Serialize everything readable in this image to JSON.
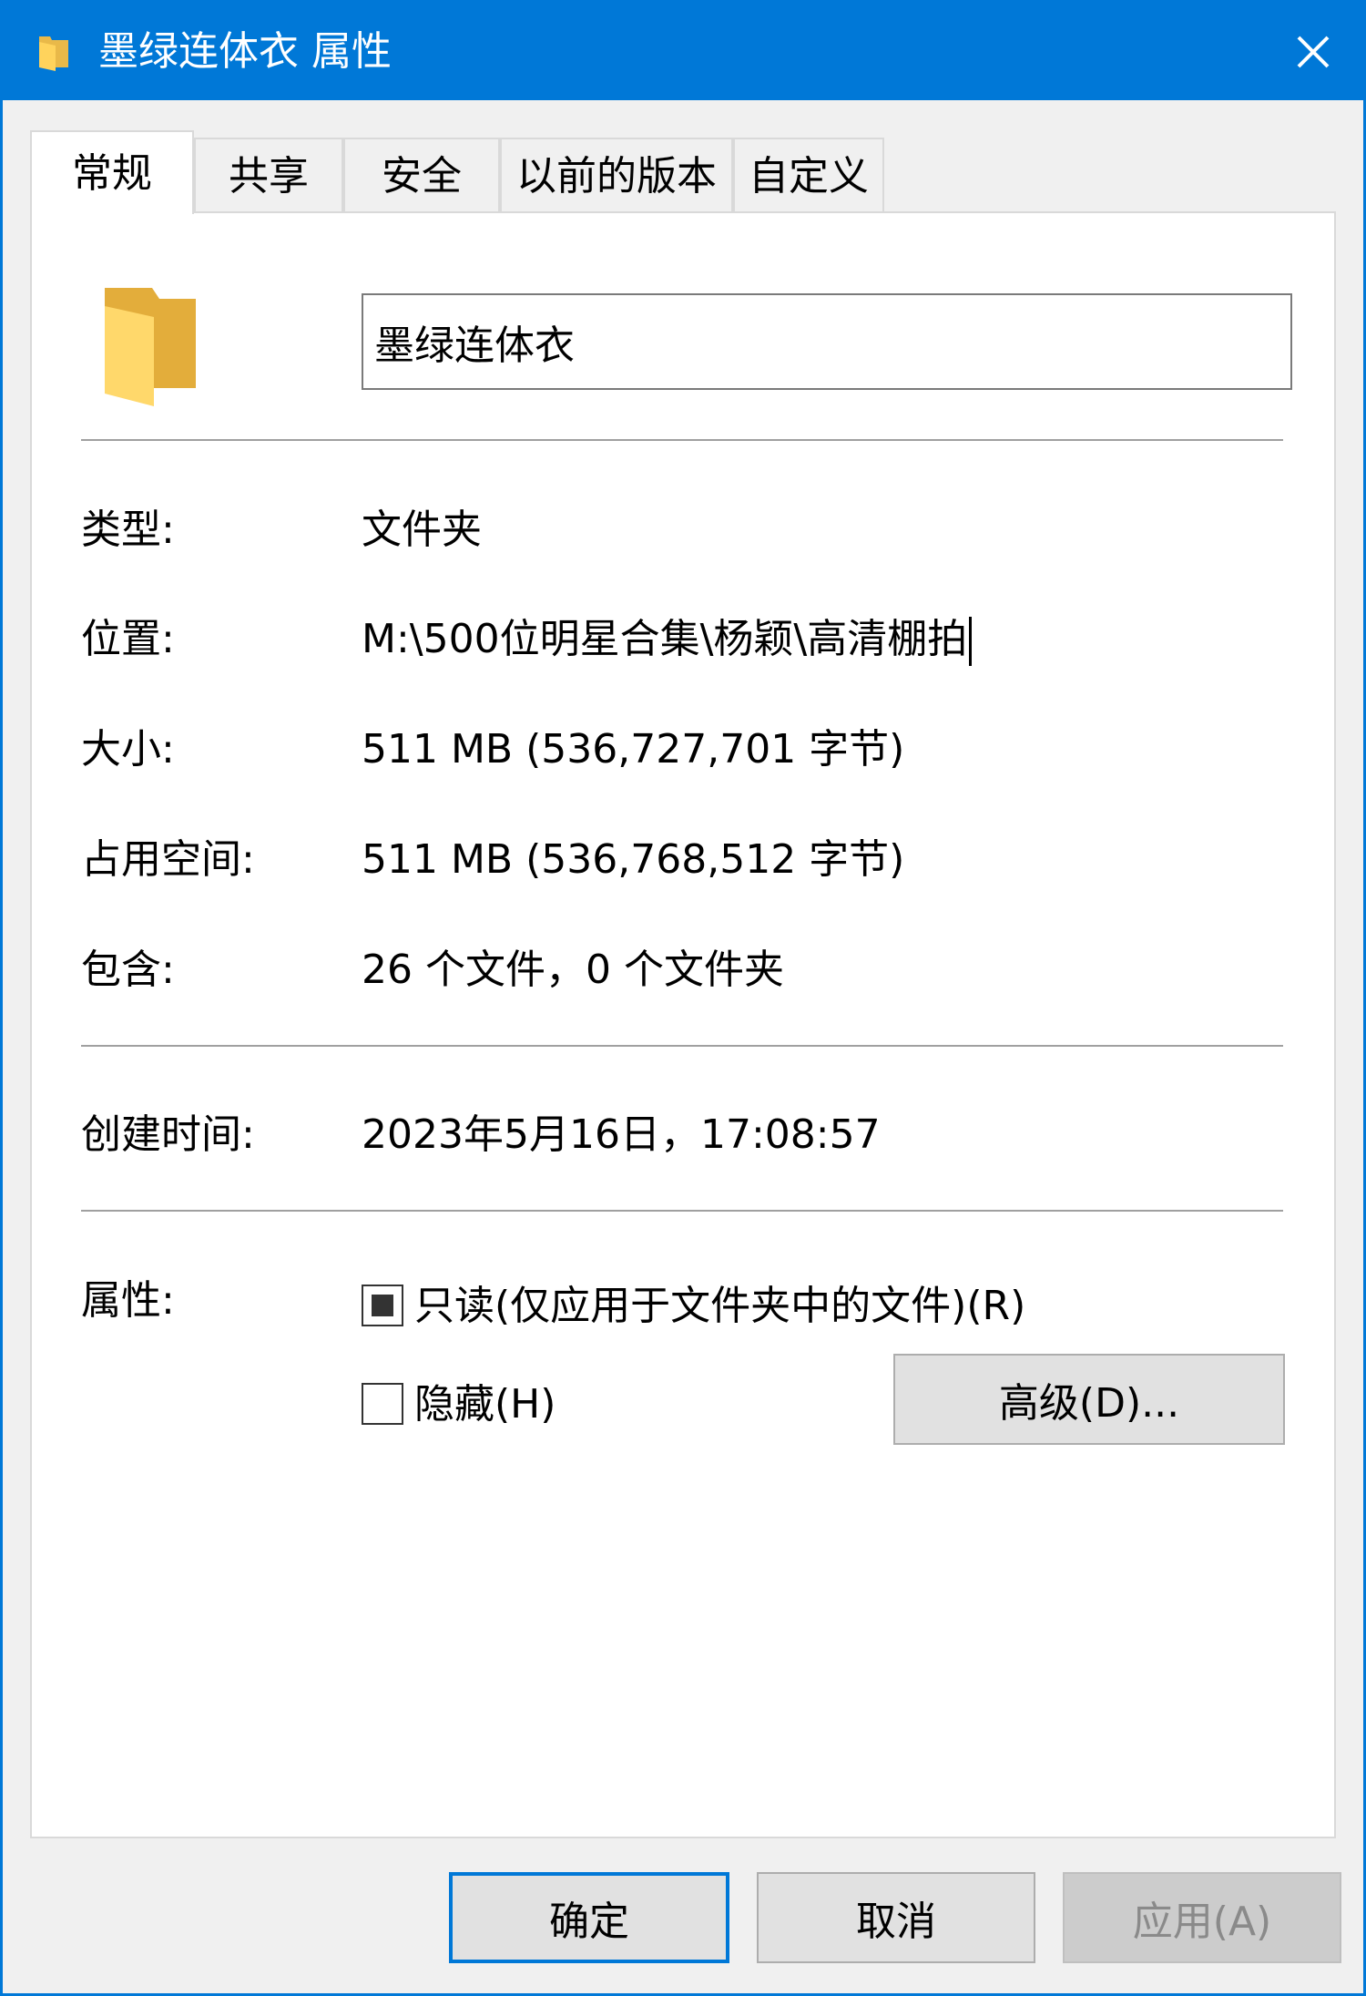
{
  "window": {
    "title": "墨绿连体衣 属性",
    "close_icon": "close-icon",
    "accent_color": "#0078d7"
  },
  "tabs": [
    {
      "label": "常规",
      "active": true
    },
    {
      "label": "共享",
      "active": false
    },
    {
      "label": "安全",
      "active": false
    },
    {
      "label": "以前的版本",
      "active": false
    },
    {
      "label": "自定义",
      "active": false
    }
  ],
  "general": {
    "folder_name": "墨绿连体衣",
    "type": {
      "label": "类型:",
      "value": "文件夹"
    },
    "location": {
      "label": "位置:",
      "value": "M:\\500位明星合集\\杨颖\\高清棚拍"
    },
    "size": {
      "label": "大小:",
      "value": "511 MB (536,727,701 字节)"
    },
    "size_on_disk": {
      "label": "占用空间:",
      "value": "511 MB (536,768,512 字节)"
    },
    "contains": {
      "label": "包含:",
      "value": "26 个文件，0 个文件夹"
    },
    "created": {
      "label": "创建时间:",
      "value": "2023年5月16日，17:08:57"
    },
    "attributes": {
      "label": "属性:",
      "readonly": {
        "label": "只读(仅应用于文件夹中的文件)(R)",
        "state": "indeterminate"
      },
      "hidden": {
        "label": "隐藏(H)",
        "state": "unchecked"
      },
      "advanced_button": "高级(D)..."
    }
  },
  "buttons": {
    "ok": "确定",
    "cancel": "取消",
    "apply": "应用(A)"
  }
}
